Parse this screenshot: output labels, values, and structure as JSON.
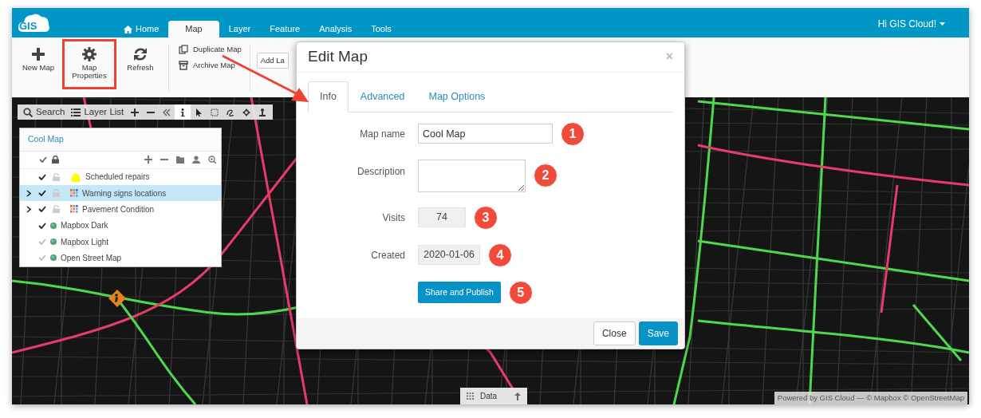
{
  "app": {
    "logo": "GIS",
    "greeting": "Hi GIS Cloud!"
  },
  "nav_tabs": [
    {
      "label": "Home",
      "kind": "home",
      "selected": false
    },
    {
      "label": "Map",
      "kind": "plain",
      "selected": true
    },
    {
      "label": "Layer",
      "kind": "plain",
      "selected": false
    },
    {
      "label": "Feature",
      "kind": "plain",
      "selected": false
    },
    {
      "label": "Analysis",
      "kind": "plain",
      "selected": false
    },
    {
      "label": "Tools",
      "kind": "plain",
      "selected": false
    }
  ],
  "ribbon": {
    "buttons": [
      {
        "label": "New Map",
        "kind": "plus",
        "highlighted": false
      },
      {
        "label": "Map Properties",
        "kind": "gear",
        "highlighted": true
      },
      {
        "label": "Refresh",
        "kind": "refresh",
        "highlighted": false
      }
    ],
    "actions": [
      {
        "label": "Duplicate Map",
        "kind": "copy"
      },
      {
        "label": "Archive Map",
        "kind": "archive"
      }
    ],
    "partial_button": "Add La"
  },
  "map_toolbar": {
    "search": "Search",
    "layer_list": "Layer List",
    "tools": [
      {
        "kind": "plus",
        "selected": false
      },
      {
        "kind": "minus",
        "selected": false
      },
      {
        "kind": "collapse",
        "selected": false
      },
      {
        "kind": "info",
        "selected": true
      },
      {
        "kind": "pointer",
        "selected": false
      },
      {
        "kind": "select",
        "selected": false
      },
      {
        "kind": "lasso",
        "selected": false
      },
      {
        "kind": "move",
        "selected": false
      },
      {
        "kind": "pin",
        "selected": false
      }
    ]
  },
  "layer_panel": {
    "title": "Cool Map",
    "layers": [
      {
        "name": "Scheduled repairs",
        "kind": "polygon",
        "expandable": false,
        "checked": true,
        "locked": false,
        "selected": false
      },
      {
        "name": "Warning signs locations",
        "kind": "points",
        "expandable": true,
        "checked": true,
        "locked": false,
        "selected": true
      },
      {
        "name": "Pavement Condition",
        "kind": "points",
        "expandable": true,
        "checked": true,
        "locked": false,
        "selected": false
      },
      {
        "name": "Mapbox Dark",
        "kind": "basemap",
        "expandable": false,
        "checked": true,
        "selected": false
      },
      {
        "name": "Mapbox Light",
        "kind": "basemap",
        "expandable": false,
        "checked": false,
        "selected": false
      },
      {
        "name": "Open Street Map",
        "kind": "basemap",
        "expandable": false,
        "checked": false,
        "selected": false
      }
    ]
  },
  "dialog": {
    "title": "Edit Map",
    "close": "×",
    "tabs": [
      {
        "label": "Info",
        "selected": true
      },
      {
        "label": "Advanced",
        "selected": false
      },
      {
        "label": "Map Options",
        "selected": false
      }
    ],
    "fields": [
      {
        "label": "Map name",
        "kind": "text",
        "value": "Cool Map",
        "callout": "1"
      },
      {
        "label": "Description",
        "kind": "textarea",
        "callout": "2"
      },
      {
        "label": "Visits",
        "kind": "readonly",
        "value": "74",
        "callout": "3"
      },
      {
        "label": "Created",
        "kind": "readonly",
        "value": "2020-01-06",
        "callout": "4"
      },
      {
        "label": "Share and Publish",
        "kind": "button",
        "callout": "5"
      }
    ],
    "buttons": [
      {
        "label": "Close",
        "kind": "secondary"
      },
      {
        "label": "Save",
        "kind": "primary"
      }
    ]
  },
  "data_tab": "Data",
  "attribution": "Powered by GIS Cloud — © Mapbox © OpenStreetMap"
}
